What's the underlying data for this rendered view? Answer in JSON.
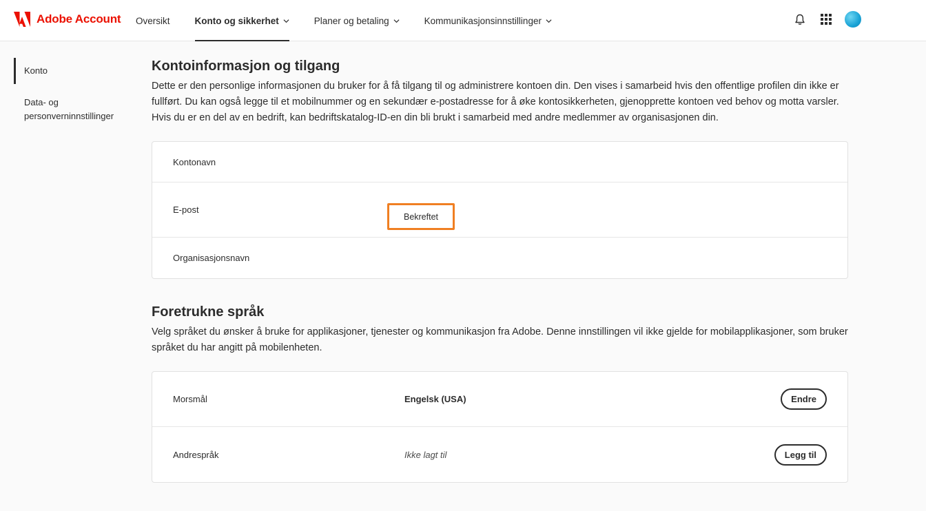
{
  "header": {
    "brand": "Adobe Account",
    "nav": [
      {
        "label": "Oversikt",
        "active": false,
        "dropdown": false
      },
      {
        "label": "Konto og sikkerhet",
        "active": true,
        "dropdown": true
      },
      {
        "label": "Planer og betaling",
        "active": false,
        "dropdown": true
      },
      {
        "label": "Kommunikasjonsinnstillinger",
        "active": false,
        "dropdown": true
      }
    ],
    "icons": [
      "bell-icon",
      "app-grid-icon",
      "avatar"
    ]
  },
  "sidebar": {
    "items": [
      {
        "label": "Konto",
        "active": true
      },
      {
        "label": "Data- og personverninnstillinger",
        "active": false
      }
    ]
  },
  "account": {
    "title": "Kontoinformasjon og tilgang",
    "description": "Dette er den personlige informasjonen du bruker for å få tilgang til og administrere kontoen din. Den vises i samarbeid hvis den offentlige profilen din ikke er fullført. Du kan også legge til et mobilnummer og en sekundær e-postadresse for å øke kontosikkerheten, gjenopprette kontoen ved behov og motta varsler. Hvis du er en del av en bedrift, kan bedriftskatalog-ID-en din bli brukt i samarbeid med andre medlemmer av organisasjonen din.",
    "rows": {
      "account_name_label": "Kontonavn",
      "email_label": "E-post",
      "email_status": "Bekreftet",
      "org_label": "Organisasjonsnavn"
    }
  },
  "languages": {
    "title": "Foretrukne språk",
    "description": "Velg språket du ønsker å bruke for applikasjoner, tjenester og kommunikasjon fra Adobe. Denne innstillingen vil ikke gjelde for mobilapplikasjoner, som bruker språket du har angitt på mobilenheten.",
    "rows": {
      "native_label": "Morsmål",
      "native_value": "Engelsk (USA)",
      "native_button": "Endre",
      "other_label": "Andrespråk",
      "other_value": "Ikke lagt til",
      "other_button": "Legg til"
    }
  },
  "colors": {
    "brand_red": "#eb1000",
    "highlight_orange": "#f07f22"
  }
}
